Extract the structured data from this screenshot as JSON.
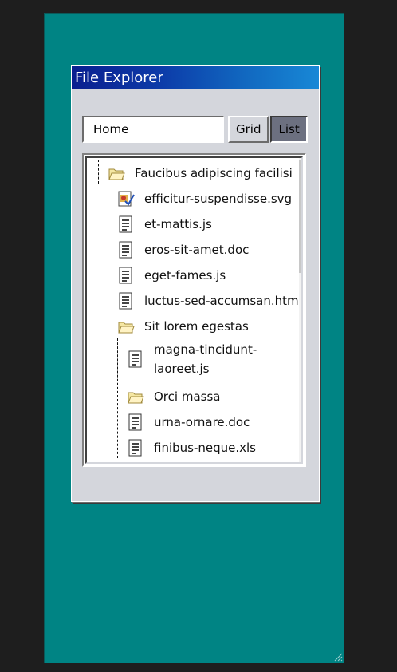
{
  "window": {
    "title": "File Explorer"
  },
  "toolbar": {
    "path_value": "Home",
    "grid_label": "Grid",
    "list_label": "List"
  },
  "tree": {
    "root": {
      "label": "Faucibus adipiscing facilisi",
      "icon": "folder-open-icon"
    },
    "root_children": [
      {
        "label": "efficitur-suspendisse.svg",
        "icon": "image-file-icon"
      },
      {
        "label": "et-mattis.js",
        "icon": "document-icon"
      },
      {
        "label": "eros-sit-amet.doc",
        "icon": "document-icon"
      },
      {
        "label": "eget-fames.js",
        "icon": "document-icon"
      },
      {
        "label": "luctus-sed-accumsan.html",
        "icon": "document-icon"
      },
      {
        "label": "Sit lorem egestas",
        "icon": "folder-open-icon"
      }
    ],
    "sub_children": [
      {
        "label": "magna-tincidunt-laoreet.js",
        "icon": "document-icon"
      },
      {
        "label": "Orci massa",
        "icon": "folder-icon"
      },
      {
        "label": "urna-ornare.doc",
        "icon": "document-icon"
      },
      {
        "label": "finibus-neque.xls",
        "icon": "document-icon"
      }
    ]
  },
  "colors": {
    "desktop": "#008484",
    "window_face": "#d4d6dc",
    "title_start": "#0a1f8f",
    "title_end": "#1888d6",
    "list_button_active": "#6c7080"
  }
}
